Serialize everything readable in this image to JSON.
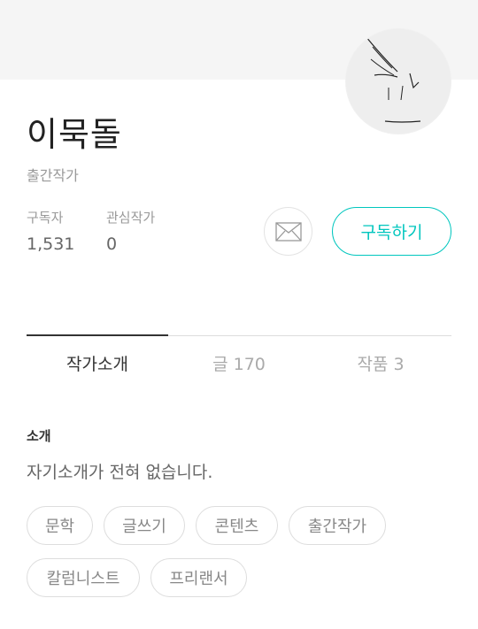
{
  "profile": {
    "name": "이묵돌",
    "role": "출간작가"
  },
  "stats": {
    "subscribers_label": "구독자",
    "subscribers_value": "1,531",
    "interest_label": "관심작가",
    "interest_value": "0"
  },
  "actions": {
    "subscribe_label": "구독하기",
    "mail_icon": "mail-icon"
  },
  "tabs": [
    {
      "label": "작가소개",
      "active": true
    },
    {
      "label": "글 170",
      "active": false
    },
    {
      "label": "작품 3",
      "active": false
    }
  ],
  "intro": {
    "heading": "소개",
    "text": "자기소개가 전혀 없습니다."
  },
  "tags": [
    "문학",
    "글쓰기",
    "콘텐츠",
    "출간작가",
    "칼럼니스트",
    "프리랜서"
  ],
  "colors": {
    "accent": "#00c6be",
    "cover": "#f5f5f5"
  }
}
